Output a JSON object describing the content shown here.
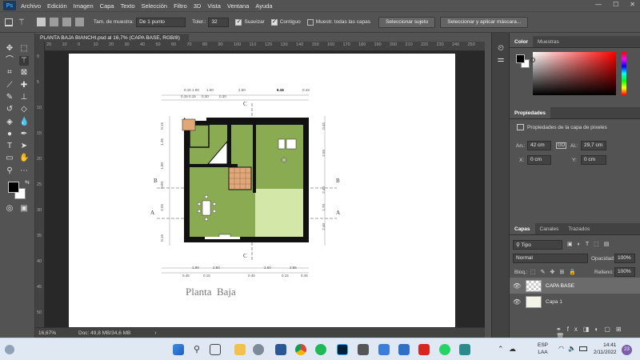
{
  "app": {
    "logo": "Ps",
    "menu": [
      "Archivo",
      "Edición",
      "Imagen",
      "Capa",
      "Texto",
      "Selección",
      "Filtro",
      "3D",
      "Vista",
      "Ventana",
      "Ayuda"
    ],
    "window_controls": [
      "—",
      "☐",
      "✕"
    ]
  },
  "options_bar": {
    "sample_size_label": "Tam. de muestra:",
    "sample_size_value": "De 1 punto",
    "tolerance_label": "Toler.:",
    "tolerance_value": "32",
    "smooth_label": "Suavizar",
    "contiguous_label": "Contiguo",
    "all_layers_label": "Muestr. todas las capas",
    "select_subject_button": "Seleccionar sujeto",
    "select_mask_button": "Seleccionar y aplicar máscara..."
  },
  "document": {
    "tab_title": "PLANTA BAJA BIANCHI.psd al 16,7% (CAPA BASE, RGB/8)",
    "tab_close": "×",
    "zoom": "16,67%",
    "doc_info": "Doc: 49,8 MB/34,6 MB",
    "plan_title": "Planta  Baja",
    "section_labels": {
      "a": "A",
      "b": "B",
      "c": "C"
    },
    "dims_top": [
      "0.15  1.00",
      "1.00",
      "2.50",
      "5.15",
      "0.43",
      "0.15 0.15",
      "0.30",
      "0.30"
    ],
    "dims_bottom": [
      "1.80",
      "2.50",
      "2.60",
      "2.55",
      "0.45",
      "0.15",
      "0.45",
      "0.15",
      "0.45"
    ],
    "dims_left": [
      "0.15",
      "1.35",
      "1.80",
      "0.60",
      "2.55",
      "0.15"
    ],
    "dims_right": [
      "0.45",
      "2.55",
      "2.40",
      "1.70",
      "2.40"
    ]
  },
  "ruler_h_labels": [
    "20",
    "10",
    "0",
    "10",
    "20",
    "30",
    "40",
    "50",
    "60",
    "70",
    "80",
    "90",
    "100",
    "110",
    "120",
    "130",
    "140",
    "150",
    "160",
    "170",
    "180",
    "190",
    "200",
    "210",
    "220",
    "230",
    "240",
    "250"
  ],
  "ruler_v_labels": [
    "0",
    "5",
    "10",
    "15",
    "20",
    "25",
    "30",
    "35",
    "40",
    "45",
    "50"
  ],
  "color_panel": {
    "tabs": [
      "Color",
      "Muestras"
    ],
    "foreground": "#000000",
    "background": "#ffffff"
  },
  "properties_panel": {
    "title": "Propiedades",
    "subtitle": "Propiedades de la capa de píxeles",
    "width_label": "An.:",
    "width_value": "42 cm",
    "height_label": "Al.:",
    "height_value": "29,7 cm",
    "x_label": "X:",
    "x_value": "0 cm",
    "y_label": "Y:",
    "y_value": "0 cm",
    "link_icon": "GO"
  },
  "layers_panel": {
    "tabs": [
      "Capas",
      "Canales",
      "Trazados"
    ],
    "filter_label": "Tipo",
    "blend_mode": "Normal",
    "opacity_label": "Opacidad:",
    "opacity_value": "100%",
    "lock_label": "Bloq.:",
    "fill_label": "Relleno:",
    "fill_value": "100%",
    "layers": [
      {
        "name": "CAPA BASE",
        "selected": true
      },
      {
        "name": "Capa 1",
        "selected": false
      }
    ]
  },
  "taskbar": {
    "lang": "ESP",
    "lang_sub": "LAA",
    "time": "14:41",
    "date": "2/11/2022",
    "badge": "23"
  },
  "colors": {
    "wall": "#111111",
    "room_green": "#8aab52",
    "patio_light": "#d3e7a8",
    "stair_orange": "#e0a77a",
    "taskbar": "#dfe8f3"
  }
}
